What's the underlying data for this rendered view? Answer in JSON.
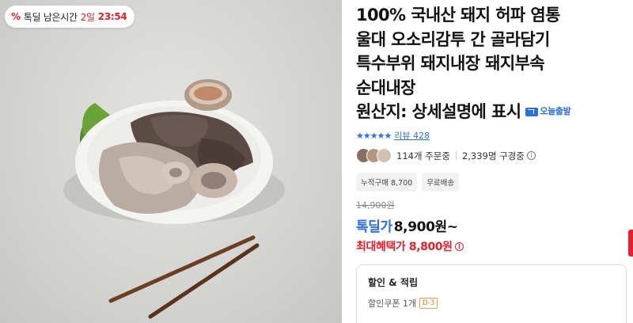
{
  "deal_badge": {
    "icon": "percent-tag-icon",
    "label": "톡딜 남은시간",
    "days": "2일",
    "time": "23:54"
  },
  "product": {
    "title_lines": [
      "100% 국내산 돼지 허파 염통",
      "울대 오소리감투 간 골라담기",
      "특수부위 돼지내장 돼지부속",
      "순대내장"
    ],
    "origin": "원산지: 상세설명에 표시",
    "shipping_badge": "오늘출발"
  },
  "rating": {
    "stars": "★★★★★",
    "review_label": "리뷰 428"
  },
  "social": {
    "orders": "114개 주문중",
    "watchers": "2,339명 구경중"
  },
  "chips": [
    "누적구매 8,700",
    "무료배송"
  ],
  "price": {
    "original": "14,900원",
    "deal_label": "톡딜가",
    "deal_amount": "8,900원~",
    "max_benefit": "최대혜택가 8,800원"
  },
  "discount": {
    "header": "할인 & 적립",
    "coupon": "할인쿠폰 1개",
    "dday": "D-3"
  },
  "colors": {
    "accent_red": "#e3202b",
    "accent_blue": "#2d6ee5"
  }
}
